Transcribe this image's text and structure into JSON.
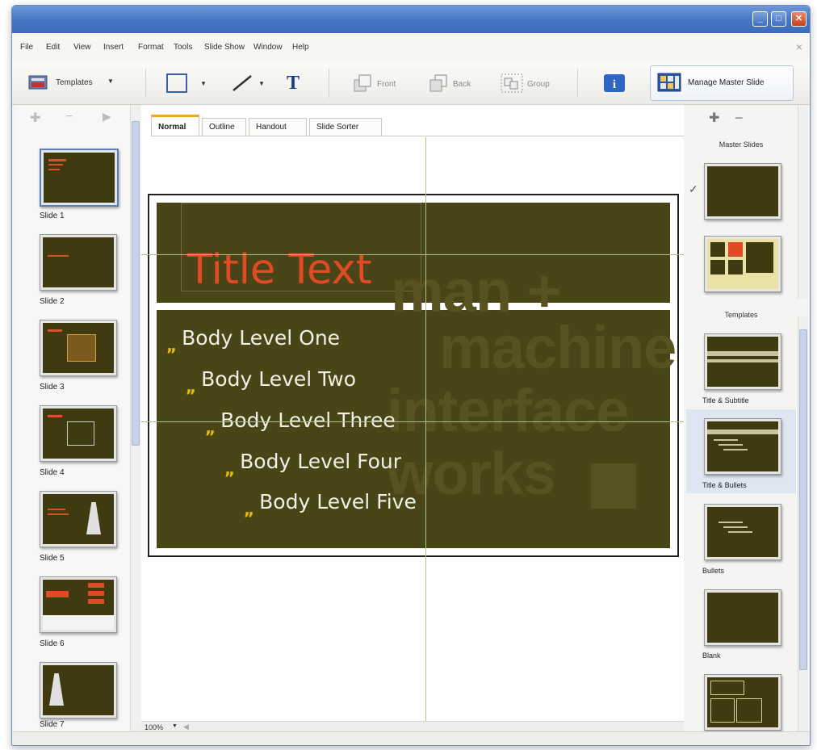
{
  "window": {
    "buttons": [
      "minimize",
      "maximize",
      "close"
    ]
  },
  "menu": {
    "items": [
      "File",
      "Edit",
      "View",
      "Insert",
      "Format",
      "Tools",
      "Slide Show",
      "Window",
      "Help"
    ]
  },
  "toolbar": {
    "templates_label": "Templates",
    "text_tool": "T",
    "front_label": "Front",
    "back_label": "Back",
    "group_label": "Group",
    "manage_master_label": "Manage Master Slide"
  },
  "tabs": [
    "Normal",
    "Outline",
    "Handout",
    "Slide Sorter"
  ],
  "active_tab": "Normal",
  "slides": [
    {
      "label": "Slide 1"
    },
    {
      "label": "Slide 2"
    },
    {
      "label": "Slide 3"
    },
    {
      "label": "Slide 4"
    },
    {
      "label": "Slide 5"
    },
    {
      "label": "Slide 6"
    },
    {
      "label": "Slide 7"
    }
  ],
  "selected_slide": "Slide 1",
  "slide": {
    "title": "Title Text",
    "bullets": [
      "Body Level One",
      "Body Level Two",
      "Body Level Three",
      "Body Level Four",
      "Body Level Five"
    ],
    "bullet_glyph": "„",
    "watermark": [
      "man +",
      "machine",
      "interface",
      "works"
    ]
  },
  "right_panel": {
    "master_header": "Master Slides",
    "templates_header": "Templates",
    "check_glyph": "✓",
    "templates": [
      {
        "label": "Title & Subtitle"
      },
      {
        "label": "Title & Bullets"
      },
      {
        "label": "Bullets"
      },
      {
        "label": "Blank"
      }
    ],
    "selected_template": "Title & Bullets"
  },
  "status": {
    "zoom": "100%"
  },
  "colors": {
    "slide_bg": "#4a4517",
    "title": "#e14a24",
    "bullet_marker": "#e5c000",
    "accent_tab": "#f0a52c"
  }
}
